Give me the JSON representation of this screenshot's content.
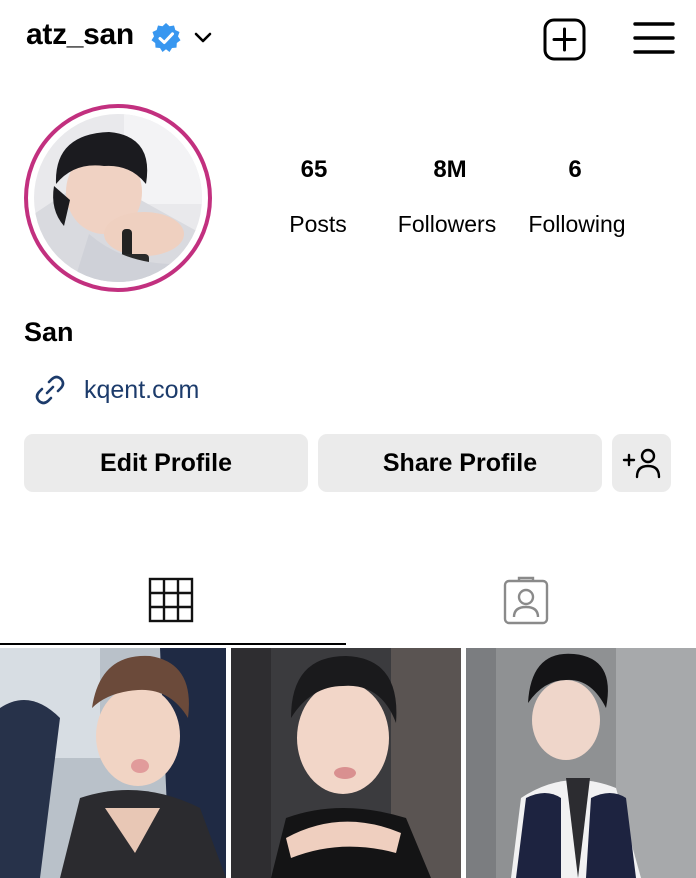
{
  "header": {
    "username": "atz_san",
    "verified_icon": "verified-badge-icon",
    "dropdown_icon": "chevron-down-icon",
    "new_post_icon": "plus-square-icon",
    "menu_icon": "hamburger-menu-icon"
  },
  "profile": {
    "name": "San",
    "link": "kqent.com",
    "link_icon": "link-icon",
    "ring_color": "#c2307f",
    "link_color": "#1c3b6b"
  },
  "stats": [
    {
      "value": "65",
      "label": "Posts"
    },
    {
      "value": "8M",
      "label": "Followers"
    },
    {
      "value": "6",
      "label": "Following"
    }
  ],
  "actions": {
    "edit": "Edit Profile",
    "share": "Share Profile",
    "add_icon": "add-person-icon"
  },
  "tabs": [
    {
      "icon": "grid-icon",
      "active": true
    },
    {
      "icon": "tagged-person-icon",
      "active": false
    }
  ],
  "posts": [
    {
      "id": "post-1"
    },
    {
      "id": "post-2"
    },
    {
      "id": "post-3"
    }
  ]
}
